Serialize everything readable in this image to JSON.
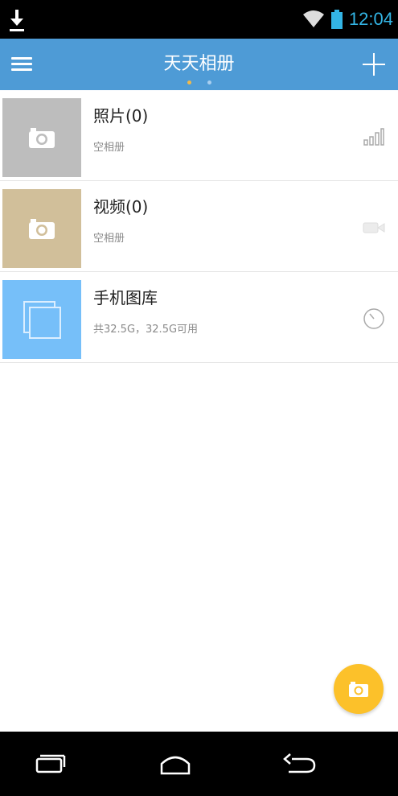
{
  "status_bar": {
    "time": "12:04",
    "icons": [
      "download-icon",
      "wifi-icon",
      "battery-icon"
    ]
  },
  "action_bar": {
    "title": "天天相册",
    "menu_icon": "hamburger-menu-icon",
    "add_icon": "plus-icon",
    "page_indicator": {
      "count": 2,
      "active": 0
    }
  },
  "albums": [
    {
      "name": "照片(0)",
      "subtitle": "空相册",
      "thumb_icon": "camera-icon",
      "thumb_color": "#bdbdbd",
      "action_icon": "signal-bars-icon"
    },
    {
      "name": "视频(0)",
      "subtitle": "空相册",
      "thumb_icon": "camera-icon",
      "thumb_color": "#d1bf9a",
      "action_icon": "video-camera-icon"
    },
    {
      "name": "手机图库",
      "subtitle": "共32.5G，32.5G可用",
      "thumb_icon": "gallery-stack-icon",
      "thumb_color": "#76bff9",
      "action_icon": "timer-icon"
    }
  ],
  "fab": {
    "icon": "camera-icon",
    "color": "#fcc12a"
  },
  "nav_bar": {
    "icons": [
      "recent-apps-icon",
      "home-icon",
      "back-icon"
    ]
  },
  "colors": {
    "accent": "#4e9bd6",
    "status_time": "#33b5e5"
  }
}
